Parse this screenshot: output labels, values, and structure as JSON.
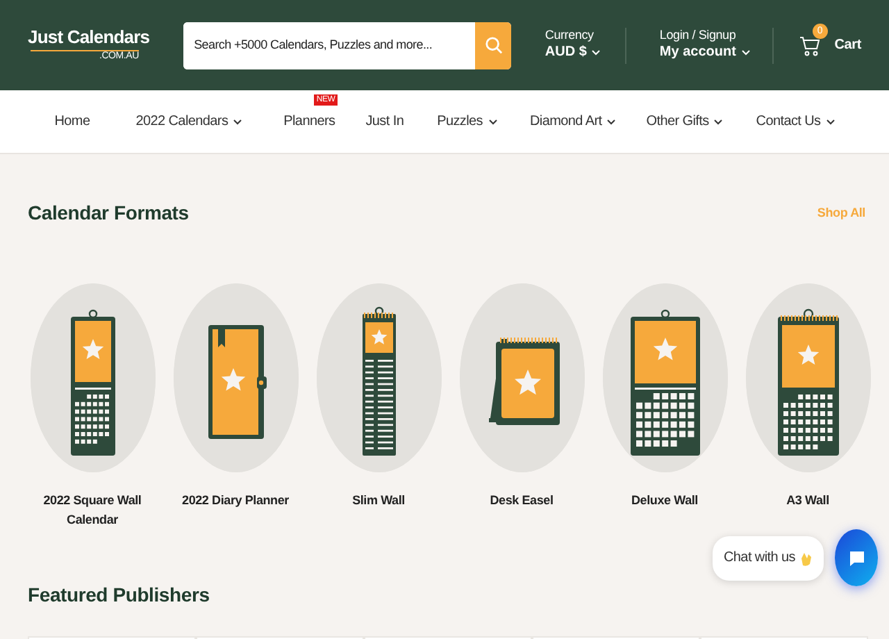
{
  "header": {
    "logo": "Just Calendars",
    "logo_sub": ".COM.AU",
    "search": {
      "placeholder": "Search +5000 Calendars, Puzzles and more..."
    },
    "currency": {
      "label": "Currency",
      "value": "AUD $"
    },
    "account": {
      "label": "Login / Signup",
      "value": "My account"
    },
    "cart": {
      "count": "0",
      "label": "Cart"
    }
  },
  "nav": [
    {
      "label": "Home",
      "dropdown": false
    },
    {
      "label": "2022 Calendars",
      "dropdown": true
    },
    {
      "label": "Planners",
      "dropdown": false,
      "badge": "NEW"
    },
    {
      "label": "Just In",
      "dropdown": false
    },
    {
      "label": "Puzzles",
      "dropdown": true
    },
    {
      "label": "Diamond Art",
      "dropdown": true
    },
    {
      "label": "Other Gifts",
      "dropdown": true
    },
    {
      "label": "Contact Us",
      "dropdown": true
    }
  ],
  "formats": {
    "title": "Calendar Formats",
    "link": "Shop All",
    "items": [
      {
        "label": "2022 Square Wall Calendar",
        "kind": "square"
      },
      {
        "label": "2022 Diary Planner",
        "kind": "diary"
      },
      {
        "label": "Slim Wall",
        "kind": "slim"
      },
      {
        "label": "Desk Easel",
        "kind": "easel"
      },
      {
        "label": "Deluxe Wall",
        "kind": "deluxe"
      },
      {
        "label": "A3 Wall",
        "kind": "a3"
      }
    ]
  },
  "publishers": {
    "title": "Featured Publishers"
  },
  "chat": {
    "label": "Chat with us"
  }
}
